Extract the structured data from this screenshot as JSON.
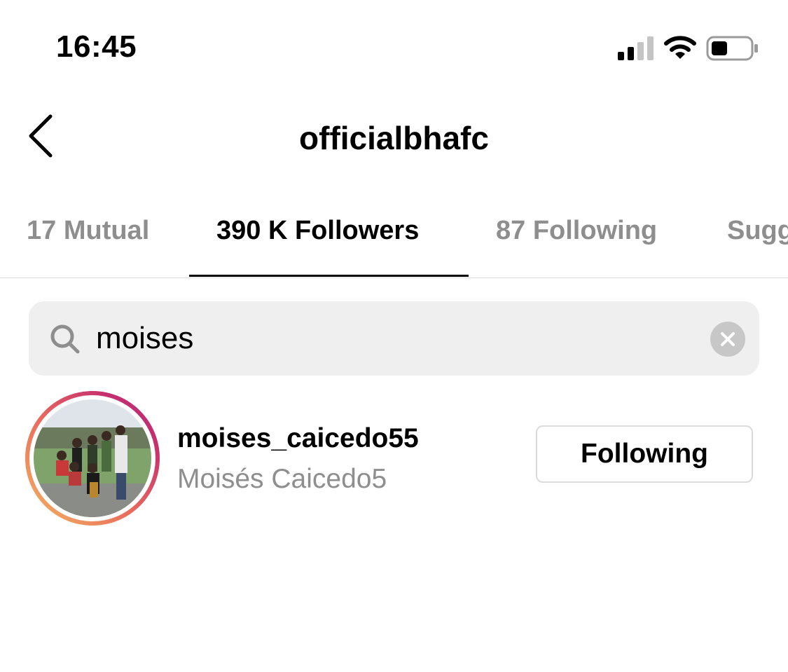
{
  "status_bar": {
    "time": "16:45",
    "signal_bars": 2,
    "battery_level": 0.35,
    "icons": [
      "signal-icon",
      "wifi-icon",
      "battery-icon"
    ]
  },
  "header": {
    "title": "officialbhafc",
    "back_icon": "chevron-left-icon"
  },
  "tabs": [
    {
      "label": "17 Mutual",
      "active": false
    },
    {
      "label": "390 K Followers",
      "active": true
    },
    {
      "label": "87 Following",
      "active": false
    },
    {
      "label": "Sugg",
      "active": false
    }
  ],
  "search": {
    "value": "moises",
    "icon": "search-icon",
    "clear_icon": "clear-icon"
  },
  "results": [
    {
      "username": "moises_caicedo55",
      "full_name": "Moisés Caicedo5",
      "button_label": "Following",
      "has_story_ring": true
    }
  ],
  "colors": {
    "text_primary": "#000000",
    "text_secondary": "#8e8e8e",
    "search_bg": "#efefef",
    "divider": "#dbdbdb",
    "story_ring_start": "#f4b860",
    "story_ring_end": "#b5287a"
  }
}
